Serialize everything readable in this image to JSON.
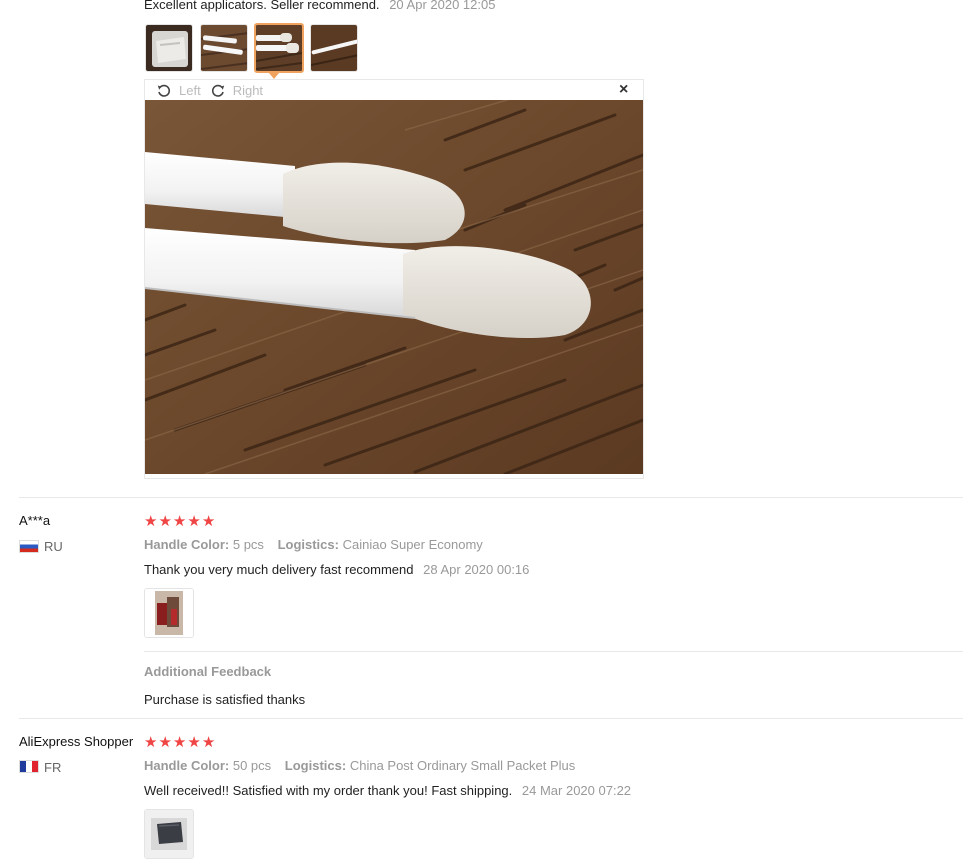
{
  "review0": {
    "text": "Excellent applicators. Seller recommend.",
    "date": "20 Apr 2020 12:05",
    "viewer": {
      "rotate_left_label": "Left",
      "rotate_right_label": "Right",
      "close_symbol": "×"
    },
    "thumb_count": 4,
    "selected_thumb": 3
  },
  "reviews": [
    {
      "reviewer": "A***a",
      "country": "RU",
      "stars": 5,
      "handle_color_label": "Handle Color:",
      "handle_color_value": "5 pcs",
      "logistics_label": "Logistics:",
      "logistics_value": "Cainiao Super Economy",
      "text": "Thank you very much delivery fast recommend",
      "date": "28 Apr 2020 00:16",
      "additional_feedback_title": "Additional Feedback",
      "additional_feedback_text": "Purchase is satisfied thanks"
    },
    {
      "reviewer": "AliExpress Shopper",
      "country": "FR",
      "stars": 5,
      "handle_color_label": "Handle Color:",
      "handle_color_value": "50 pcs",
      "logistics_label": "Logistics:",
      "logistics_value": "China Post Ordinary Small Packet Plus",
      "text": "Well received!! Satisfied with my order thank you! Fast shipping.",
      "date": "24 Mar 2020 07:22"
    }
  ],
  "icons": {
    "star": "★",
    "rotate_left": "rotate-left-icon",
    "rotate_right": "rotate-right-icon",
    "close": "close-icon"
  },
  "colors": {
    "star": "#f04545",
    "selected_border": "#f0a35e",
    "muted_text": "#999999"
  }
}
